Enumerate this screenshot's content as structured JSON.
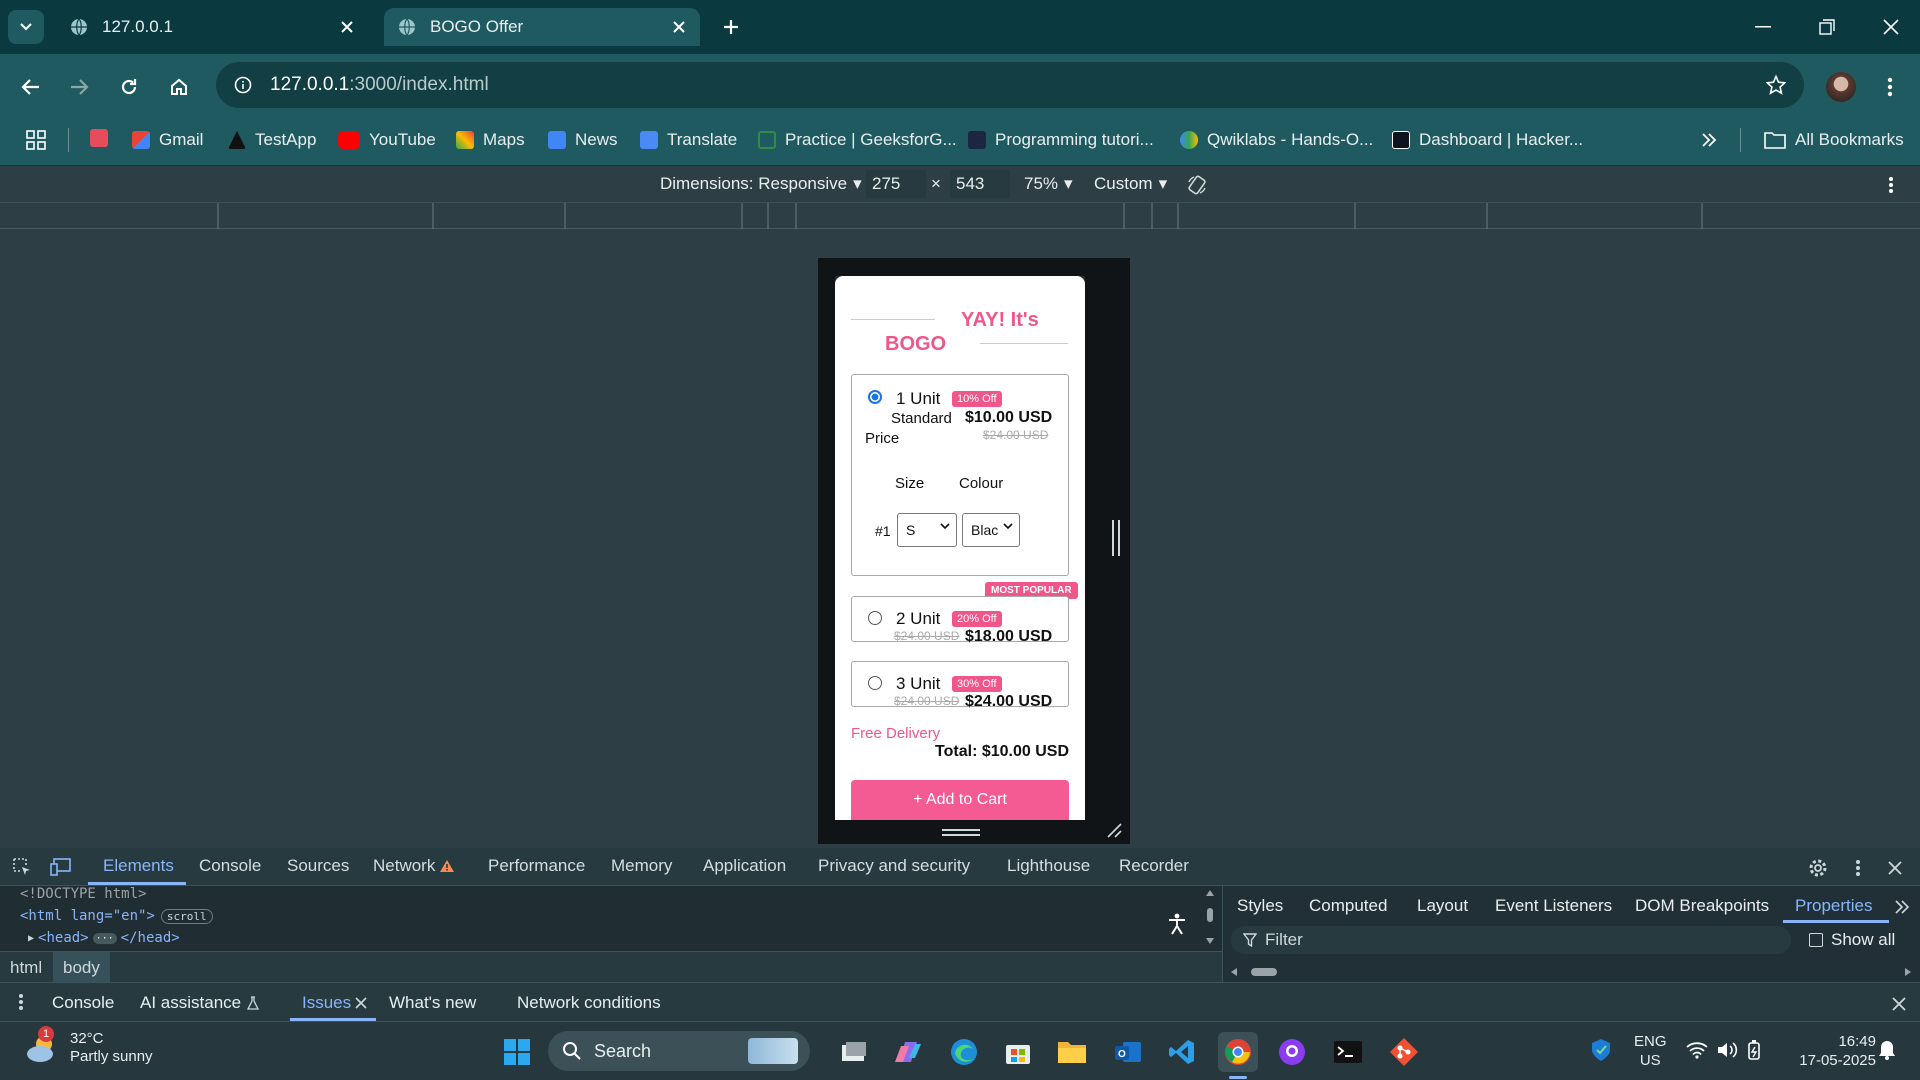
{
  "browser": {
    "tabs": [
      {
        "title": "127.0.0.1"
      },
      {
        "title": "BOGO Offer"
      }
    ],
    "url": {
      "host": "127.0.0.1",
      "path": ":3000/index.html"
    },
    "bookmarks": [
      "Gmail",
      "TestApp",
      "YouTube",
      "Maps",
      "News",
      "Translate",
      "Practice | GeeksforG...",
      "Programming tutori...",
      "Qwiklabs - Hands-O...",
      "Dashboard | Hacker..."
    ],
    "all_bookmarks": "All Bookmarks"
  },
  "device_toolbar": {
    "dimensions_label": "Dimensions: Responsive",
    "width": "275",
    "times": "×",
    "height": "543",
    "zoom": "75%",
    "throttle": "Custom"
  },
  "bogo": {
    "title_right": "YAY! It's",
    "title_left": "BOGO",
    "options": [
      {
        "label": "1 Unit",
        "badge": "10% Off",
        "line1": "Standard",
        "price": "$10.00 USD",
        "line2": "Price",
        "old_price": "$24.00 USD",
        "selected": true
      },
      {
        "label": "2 Unit",
        "badge": "20% Off",
        "old_price": "$24.00 USD",
        "price": "$18.00 USD",
        "tag": "MOST POPULAR"
      },
      {
        "label": "3 Unit",
        "badge": "30% Off",
        "old_price": "$24.00 USD",
        "price": "$24.00 USD"
      }
    ],
    "size_header": "Size",
    "colour_header": "Colour",
    "row_label": "#1",
    "size_value": "S",
    "colour_value": "Blac",
    "free_delivery": "Free Delivery",
    "total": "Total: $10.00 USD",
    "add_to_cart": "+ Add to Cart"
  },
  "devtools": {
    "tabs": [
      "Elements",
      "Console",
      "Sources",
      "Network",
      "Performance",
      "Memory",
      "Application",
      "Privacy and security",
      "Lighthouse",
      "Recorder"
    ],
    "dom": {
      "doctype": "<!DOCTYPE html>",
      "html_open": "<html lang=\"en\">",
      "scroll_badge": "scroll",
      "head": "<head>",
      "head_close": "</head>"
    },
    "crumbs": [
      "html",
      "body"
    ],
    "side_tabs": [
      "Styles",
      "Computed",
      "Layout",
      "Event Listeners",
      "DOM Breakpoints",
      "Properties"
    ],
    "filter_placeholder": "Filter",
    "show_all": "Show all",
    "drawer_tabs": [
      "Console",
      "AI assistance",
      "Issues",
      "What's new",
      "Network conditions"
    ]
  },
  "taskbar": {
    "weather_temp": "32°C",
    "weather_desc": "Partly sunny",
    "weather_badge": "1",
    "search": "Search",
    "lang1": "ENG",
    "lang2": "US",
    "time": "16:49",
    "date": "17-05-2025"
  },
  "colors": {
    "accent": "#f0568a",
    "chrome_teal": "#1f5a60",
    "tab_strip": "#0a3a40",
    "devtools_active": "#8ab4f8"
  }
}
